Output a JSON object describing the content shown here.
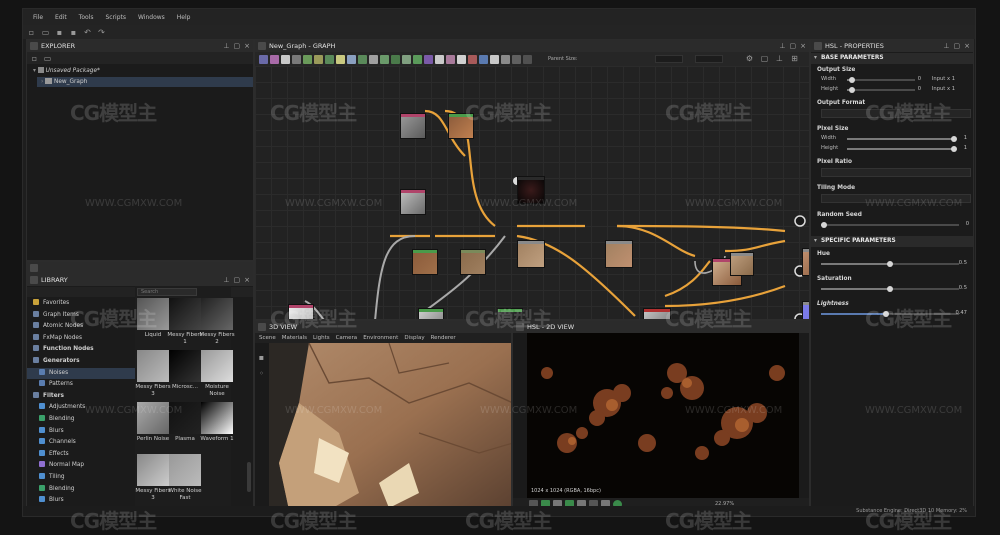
{
  "menu": [
    "File",
    "Edit",
    "Tools",
    "Scripts",
    "Windows",
    "Help"
  ],
  "explorer": {
    "title": "EXPLORER",
    "package": "Unsaved Package*",
    "graph": "New_Graph"
  },
  "graph_panel": {
    "title": "New_Graph - GRAPH",
    "parent_size_label": "Parent Size:"
  },
  "library": {
    "title": "LIBRARY",
    "search_placeholder": "Search",
    "categories": [
      {
        "label": "Favorites",
        "color": "#c9a23a"
      },
      {
        "label": "Graph Items",
        "color": "#6a7fa0"
      },
      {
        "label": "Atomic Nodes",
        "color": "#6a7fa0"
      },
      {
        "label": "FxMap Nodes",
        "color": "#6a7fa0"
      },
      {
        "label": "Function Nodes",
        "color": "#6a7fa0"
      },
      {
        "label": "Generators",
        "color": "#6a7fa0"
      },
      {
        "label": "Noises",
        "color": "#5a7db0"
      },
      {
        "label": "Patterns",
        "color": "#5a7db0"
      },
      {
        "label": "Filters",
        "color": "#6a7fa0"
      },
      {
        "label": "Adjustments",
        "color": "#4f8fd0"
      },
      {
        "label": "Blending",
        "color": "#3aa06a"
      },
      {
        "label": "Blurs",
        "color": "#4f8fd0"
      },
      {
        "label": "Channels",
        "color": "#4f8fd0"
      },
      {
        "label": "Effects",
        "color": "#4f8fd0"
      },
      {
        "label": "Normal Map",
        "color": "#8f6fd0"
      },
      {
        "label": "Tiling",
        "color": "#4f8fd0"
      },
      {
        "label": "Blending",
        "color": "#3aa06a"
      },
      {
        "label": "Blurs",
        "color": "#4f8fd0"
      }
    ],
    "thumbnails": [
      {
        "label": "Liquid"
      },
      {
        "label": "Messy Fibers 1"
      },
      {
        "label": "Messy Fibers 2"
      },
      {
        "label": "Messy Fibers 3"
      },
      {
        "label": "Microsc..."
      },
      {
        "label": "Moisture Noise"
      },
      {
        "label": "Perlin Noise"
      },
      {
        "label": "Plasma"
      },
      {
        "label": "Waveform 1"
      },
      {
        "label": "Messy Fibers 3"
      },
      {
        "label": "White Noise Fast"
      }
    ]
  },
  "view3d": {
    "title": "3D VIEW",
    "tabs": [
      "Scene",
      "Materials",
      "Lights",
      "Camera",
      "Environment",
      "Display",
      "Renderer"
    ]
  },
  "view2d": {
    "title": "HSL - 2D VIEW",
    "resolution": "1024 x 1024 (RGBA, 16bpc)",
    "zoom": "22.97%"
  },
  "properties": {
    "title": "HSL - PROPERTIES",
    "base_section": "BASE PARAMETERS",
    "output_size_label": "Output Size",
    "width_label": "Width",
    "height_label": "Height",
    "width_value": "0",
    "height_value": "0",
    "width_input": "Input x 1",
    "height_input": "Input x 1",
    "output_format_label": "Output Format",
    "pixel_size_label": "Pixel Size",
    "pixel_width_value": "1",
    "pixel_height_value": "1",
    "pixel_ratio_label": "Pixel Ratio",
    "tiling_mode_label": "Tiling Mode",
    "random_seed_label": "Random Seed",
    "random_seed_value": "0",
    "specific_section": "SPECIFIC PARAMETERS",
    "hue_label": "Hue",
    "hue_value": "0.5",
    "saturation_label": "Saturation",
    "saturation_value": "0.5",
    "lightness_label": "Lightness",
    "lightness_value": "0.47"
  },
  "status": {
    "engine": "Substance Engine: Direct3D 10  Memory: 2%"
  },
  "watermarks": {
    "brand": "CG模型主",
    "url": "WWW.CGMXW.COM"
  },
  "colors": {
    "accent_wire": "#e8a23a",
    "wire_gray": "#a9a9a9",
    "node_purple": "#7a7ae8",
    "panel_bg": "#1b1b1b"
  }
}
